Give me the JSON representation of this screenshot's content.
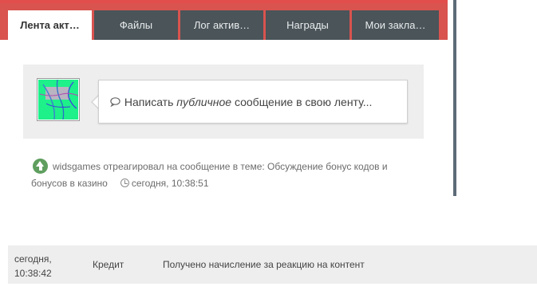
{
  "tabs": [
    {
      "label": "Лента акт…",
      "active": true
    },
    {
      "label": "Файлы",
      "active": false
    },
    {
      "label": "Лог актив…",
      "active": false
    },
    {
      "label": "Награды",
      "active": false
    },
    {
      "label": "Мои закла…",
      "active": false
    }
  ],
  "composer": {
    "icon": "speech-bubble-icon",
    "prefix": "Написать ",
    "emphasis": "публичное",
    "suffix": " сообщение в свою ленту..."
  },
  "activity": {
    "icon": "arrow-up-circle-icon",
    "text": "widsgames отреагировал на сообщение в теме: Обсуждение бонус кодов и бонусов в казино",
    "time_icon": "clock-icon",
    "time": "сегодня, 10:38:51"
  },
  "ledger_row": {
    "date_line1": "сегодня,",
    "date_line2": "10:38:42",
    "type": "Кредит",
    "description": "Получено начисление за реакцию на контент"
  },
  "colors": {
    "tab_bar_bg": "#d9534f",
    "tab_bg": "#4a5459",
    "tab_active_bg": "#ffffff",
    "panel_bg": "#eeeeee",
    "reaction_icon": "#5f9e5f",
    "right_rule": "#5d6b78"
  }
}
